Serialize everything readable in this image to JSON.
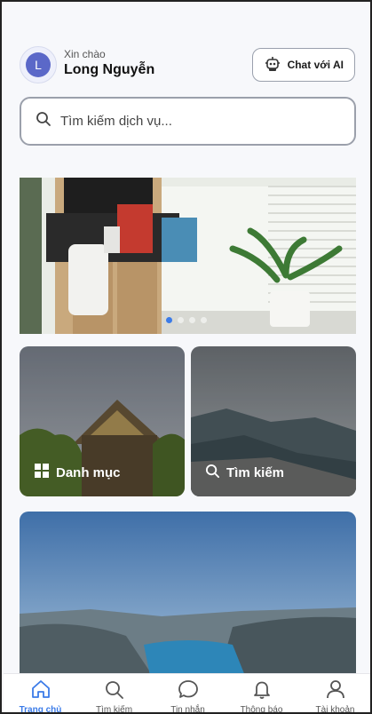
{
  "header": {
    "avatar_letter": "L",
    "greeting": "Xin chào",
    "user_name": "Long Nguyễn",
    "chat_button_label": "Chat với AI"
  },
  "search": {
    "placeholder": "Tìm kiếm dịch vụ..."
  },
  "banner": {
    "dots_total": 4,
    "active_dot": 1
  },
  "cards": [
    {
      "label": "Danh mục",
      "icon": "grid-icon"
    },
    {
      "label": "Tìm kiếm",
      "icon": "search-icon"
    }
  ],
  "bottom_nav": [
    {
      "label": "Trang chủ",
      "icon": "home-icon",
      "active": true
    },
    {
      "label": "Tìm kiếm",
      "icon": "search-icon",
      "active": false
    },
    {
      "label": "Tin nhắn",
      "icon": "chat-bubble-icon",
      "active": false
    },
    {
      "label": "Thông báo",
      "icon": "bell-icon",
      "active": false
    },
    {
      "label": "Tài khoản",
      "icon": "user-icon",
      "active": false
    }
  ],
  "colors": {
    "accent": "#3b7be8",
    "avatar": "#5b68c8"
  }
}
